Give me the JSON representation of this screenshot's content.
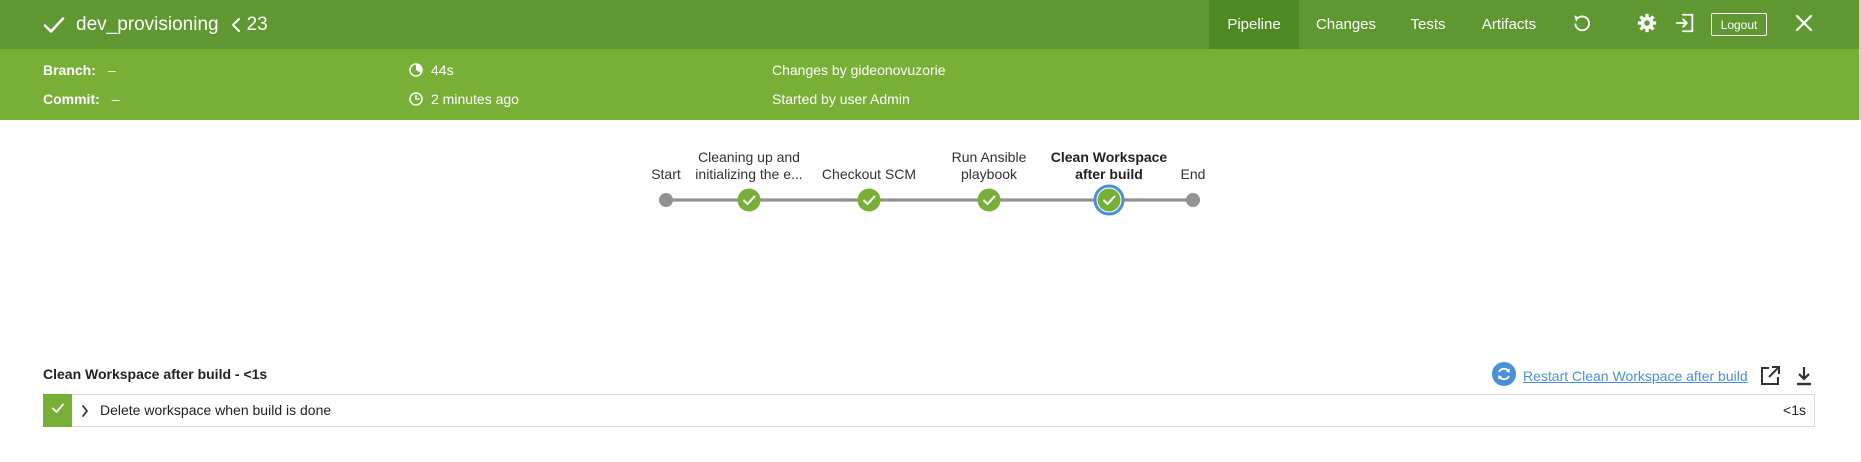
{
  "header": {
    "title": "dev_provisioning",
    "run_number": "23",
    "tabs": [
      {
        "label": "Pipeline",
        "active": true
      },
      {
        "label": "Changes",
        "active": false
      },
      {
        "label": "Tests",
        "active": false
      },
      {
        "label": "Artifacts",
        "active": false
      }
    ],
    "logout_label": "Logout",
    "icons": [
      "check-icon",
      "chevron-left-icon",
      "replay-icon",
      "gear-icon",
      "exit-icon",
      "close-icon"
    ]
  },
  "meta": {
    "branch_label": "Branch:",
    "branch_value": "–",
    "commit_label": "Commit:",
    "commit_value": "–",
    "duration": "44s",
    "started_ago": "2 minutes ago",
    "changes_by": "Changes by gideonovuzorie",
    "started_by": "Started by user Admin"
  },
  "pipeline": {
    "stages": [
      {
        "label_lines": [
          "Start"
        ],
        "status": "none"
      },
      {
        "label_lines": [
          "Cleaning up and",
          "initializing the e..."
        ],
        "status": "success"
      },
      {
        "label_lines": [
          "Checkout SCM"
        ],
        "status": "success"
      },
      {
        "label_lines": [
          "Run Ansible",
          "playbook"
        ],
        "status": "success"
      },
      {
        "label_lines": [
          "Clean Workspace",
          "after build"
        ],
        "status": "success",
        "selected": true
      },
      {
        "label_lines": [
          "End"
        ],
        "status": "none"
      }
    ]
  },
  "detail": {
    "section_title": "Clean Workspace after build - <1s",
    "restart_label": "Restart Clean Workspace after build",
    "steps": [
      {
        "text": "Delete workspace when build is done",
        "duration": "<1s",
        "status": "success"
      }
    ]
  },
  "colors": {
    "header_green": "#78b037",
    "topbar_green": "#5f9830",
    "active_tab": "#4d8a22",
    "success": "#78b037",
    "selected_ring": "#4a90d9",
    "link_blue": "#4a90d9",
    "track_gray": "#949393"
  }
}
